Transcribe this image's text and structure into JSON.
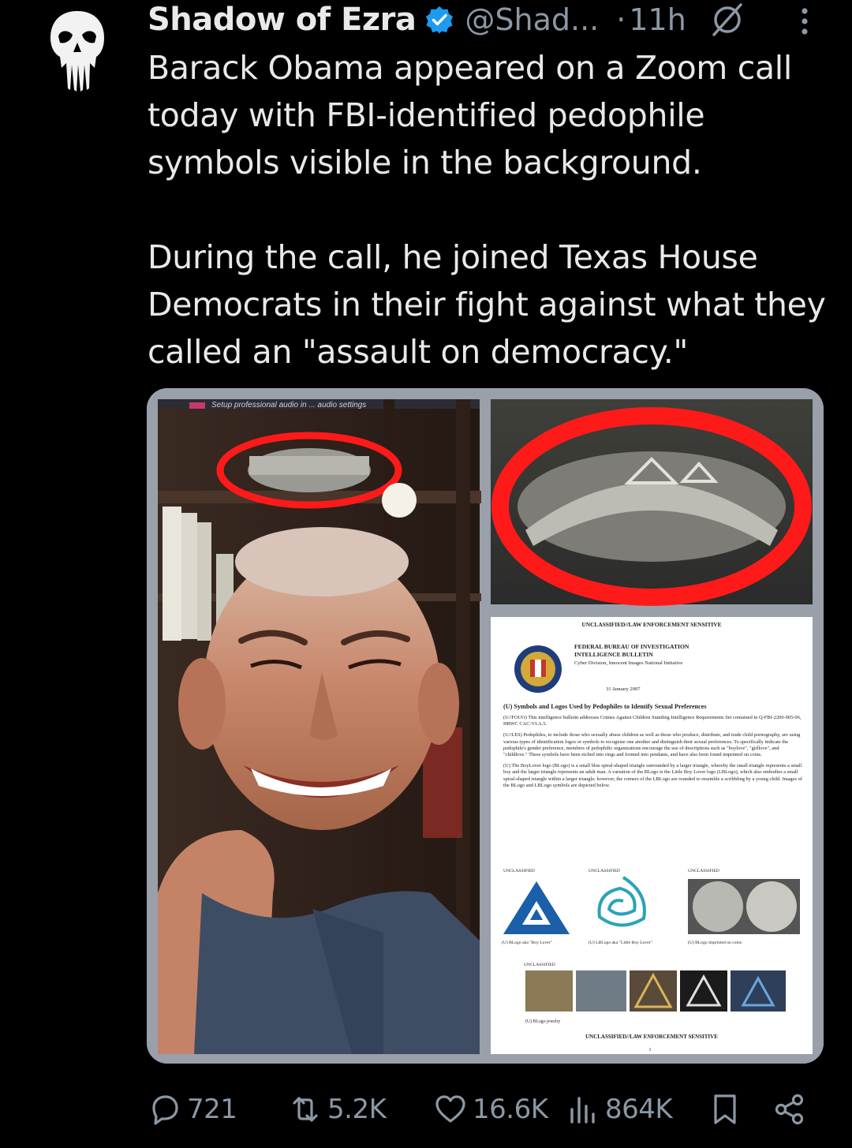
{
  "post": {
    "display_name": "Shadow of Ezra",
    "handle": "@Shad...",
    "separator": "·",
    "time": "11h",
    "text_paragraph_1": "Barack Obama appeared on a Zoom call today with FBI-identified pedophile symbols visible in the background.",
    "text_paragraph_2": "During the call, he joined Texas House Democrats in their fight against what they called an \"assault on democracy.\""
  },
  "media": {
    "left_banner": "Setup professional audio in ... audio settings",
    "document": {
      "header": "UNCLASSIFIED//LAW ENFORCEMENT SENSITIVE",
      "agency": "FEDERAL BUREAU OF INVESTIGATION",
      "bulletin": "INTELLIGENCE BULLETIN",
      "division": "Cyber Division, Innocent Images National Initiative",
      "date": "31 January 2007",
      "title": "(U) Symbols and Logos Used by Pedophiles to Identify Sexual Preferences",
      "para1": "(U//FOUO) This intelligence bulletin addresses Crimes Against Children Standing Intelligence Requirements Set contained in Q-FBI-2200-005-06, HRWC CAC-VI.A.5.",
      "para2": "(U//LES) Pedophiles, to include those who sexually abuse children as well as those who produce, distribute, and trade child pornography, are using various types of identification logos or symbols to recognize one another and distinguish their sexual preferences. To specifically indicate the pedophile's gender preference, members of pedophilic organizations encourage the use of descriptions such as \"boylove\", \"girllove\", and \"childlove.\" These symbols have been etched into rings and formed into pendants, and have also been found imprinted on coins.",
      "para3": "(U) The BoyLover logo (BLogo) is a small blue spiral-shaped triangle surrounded by a larger triangle, whereby the small triangle represents a small boy and the larger triangle represents an adult man. A variation of the BLogo is the Little Boy Lover logo (LBLogo), which also embodies a small spiral-shaped triangle within a larger triangle; however, the corners of the LBLogo are rounded to resemble a scribbling by a young child. Images of the BLogo and LBLogo symbols are depicted below.",
      "unclassified": "UNCLASSIFIED",
      "caption1": "(U) BLogo aka \"Boy Lover\"",
      "caption2": "(U) LBLogo aka \"Little Boy Lover\"",
      "caption3": "(U) BLogo imprinted on coins",
      "caption4": "(U) BLogo jewelry",
      "footer": "UNCLASSIFIED//LAW ENFORCEMENT SENSITIVE",
      "page": "1"
    }
  },
  "actions": {
    "replies": "721",
    "reposts": "5.2K",
    "likes": "16.6K",
    "views": "864K"
  },
  "colors": {
    "background": "#000000",
    "text": "#e7e9ea",
    "secondary": "#8b98a5",
    "verified": "#1d9bf0",
    "highlight_circle": "#ff1a1a"
  },
  "icons": {
    "avatar": "punisher-skull-icon",
    "verified": "verified-badge-icon",
    "grok": "grok-icon",
    "more": "more-vertical-icon",
    "reply": "reply-icon",
    "repost": "repost-icon",
    "like": "heart-icon",
    "views": "views-chart-icon",
    "bookmark": "bookmark-icon",
    "share": "share-icon"
  }
}
